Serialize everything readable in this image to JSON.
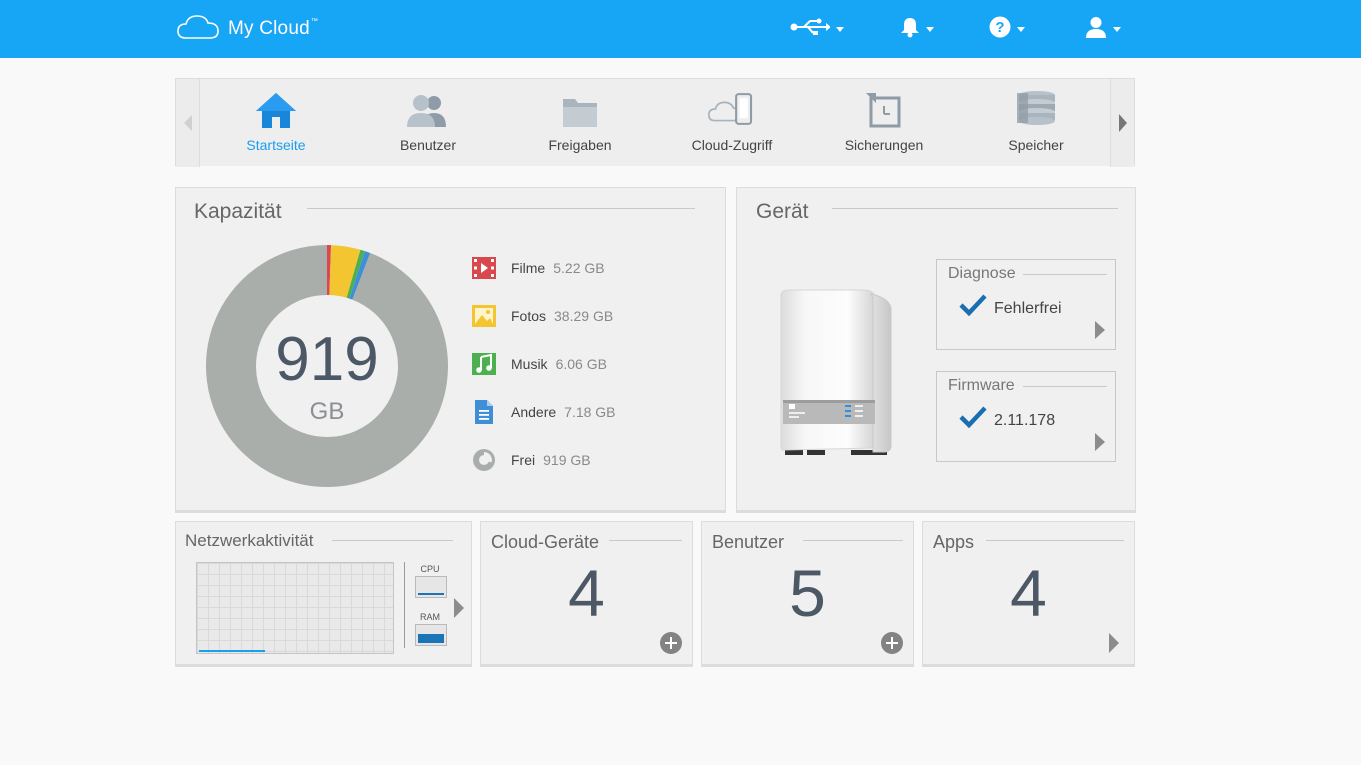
{
  "header": {
    "app_title": "My Cloud",
    "trademark": "™",
    "icons": [
      "usb-icon",
      "bell-icon",
      "help-icon",
      "user-icon"
    ]
  },
  "nav": {
    "items": [
      {
        "label": "Startseite",
        "icon": "home-icon",
        "active": true
      },
      {
        "label": "Benutzer",
        "icon": "users-icon",
        "active": false
      },
      {
        "label": "Freigaben",
        "icon": "folder-icon",
        "active": false
      },
      {
        "label": "Cloud-Zugriff",
        "icon": "cloud-phone-icon",
        "active": false
      },
      {
        "label": "Sicherungen",
        "icon": "backup-icon",
        "active": false
      },
      {
        "label": "Speicher",
        "icon": "storage-icon",
        "active": false
      }
    ]
  },
  "capacity": {
    "title": "Kapazität",
    "total_value": "919",
    "total_unit": "GB",
    "items": [
      {
        "name": "Filme",
        "value": "5.22 GB",
        "icon": "film-icon",
        "color": "#d9474f"
      },
      {
        "name": "Fotos",
        "value": "38.29 GB",
        "icon": "photo-icon",
        "color": "#f2c531"
      },
      {
        "name": "Musik",
        "value": "6.06 GB",
        "icon": "music-icon",
        "color": "#4caf50"
      },
      {
        "name": "Andere",
        "value": "7.18 GB",
        "icon": "document-icon",
        "color": "#3f8fd6"
      },
      {
        "name": "Frei",
        "value": "919 GB",
        "icon": "pie-icon",
        "color": "#a9aeab"
      }
    ]
  },
  "device": {
    "title": "Gerät",
    "diagnose": {
      "title": "Diagnose",
      "value": "Fehlerfrei"
    },
    "firmware": {
      "title": "Firmware",
      "value": "2.11.178"
    }
  },
  "network": {
    "title": "Netzwerkaktivität",
    "cpu_label": "CPU",
    "ram_label": "RAM",
    "cpu_level": 0.05,
    "ram_level": 0.55
  },
  "cloud_devices": {
    "title": "Cloud-Geräte",
    "count": "4"
  },
  "users": {
    "title": "Benutzer",
    "count": "5"
  },
  "apps": {
    "title": "Apps",
    "count": "4"
  },
  "colors": {
    "accent": "#17a5f5",
    "active_nav": "#1a9df0",
    "value_text": "#4d5866"
  }
}
